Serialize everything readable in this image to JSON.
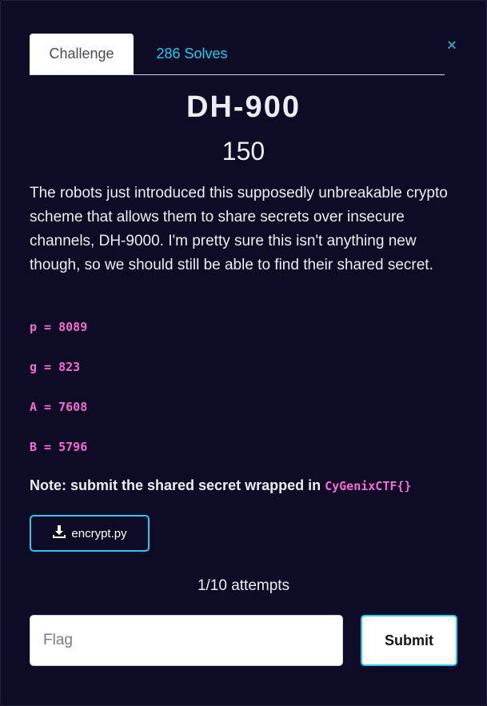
{
  "tabs": {
    "challenge_label": "Challenge",
    "solves_label": "286 Solves"
  },
  "close_icon": "×",
  "challenge": {
    "title": "DH-900",
    "points": "150",
    "description": "The robots just introduced this supposedly unbreakable crypto scheme that allows them to share secrets over insecure channels, DH-9000. I'm pretty sure this isn't anything new though, so we should still be able to find their shared secret.",
    "params": [
      "p = 8089",
      "g = 823",
      "A = 7608",
      "B = 5796"
    ],
    "note_prefix": "Note: submit the shared secret wrapped in",
    "note_code": "CyGenixCTF{}"
  },
  "file": {
    "icon": "download-icon",
    "name": "encrypt.py"
  },
  "attempts": "1/10 attempts",
  "flag": {
    "placeholder": "Flag",
    "value": ""
  },
  "submit_label": "Submit",
  "colors": {
    "background": "#0e0c24",
    "accent": "#2bc8f0",
    "code": "#f36bd4"
  }
}
